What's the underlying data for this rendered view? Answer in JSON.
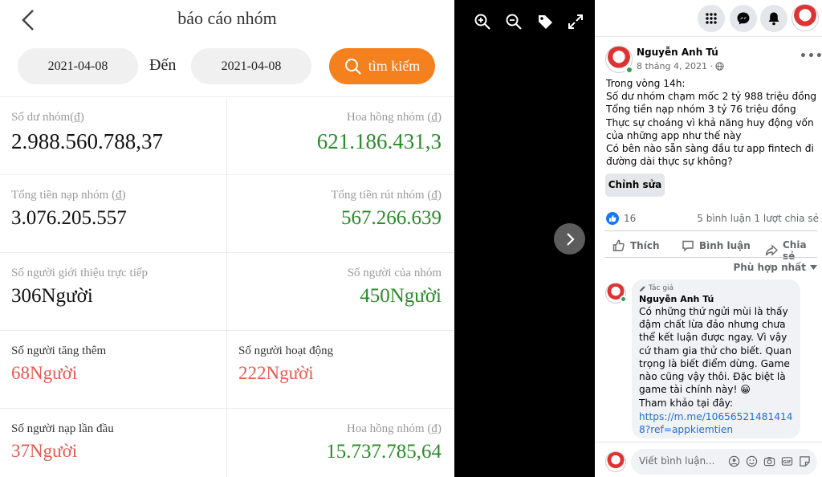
{
  "report": {
    "title": "báo cáo nhóm",
    "date_from": "2021-04-08",
    "den_label": "Đến",
    "date_to": "2021-04-08",
    "search_label": "tìm kiếm",
    "cells": [
      {
        "label": "Số dư nhóm(₫)",
        "value": "2.988.560.788,37"
      },
      {
        "label": "Hoa hồng nhóm (₫)",
        "value": "621.186.431,3"
      },
      {
        "label": "Tổng tiền nạp nhóm (₫)",
        "value": "3.076.205.557"
      },
      {
        "label": "Tổng tiền rút nhóm (₫)",
        "value": "567.266.639"
      },
      {
        "label": "Số người giới thiệu trực tiếp",
        "value": "306Người"
      },
      {
        "label": "Số người của nhóm",
        "value": "450Người"
      },
      {
        "label": "Số người tăng thêm",
        "value": "68Người"
      },
      {
        "label": "Số người hoạt động",
        "value": "222Người"
      },
      {
        "label": "Số người nạp lần đầu",
        "value": "37Người"
      },
      {
        "label": "Hoa hồng nhóm (₫)",
        "value": "15.737.785,64"
      }
    ]
  },
  "viewer": {
    "icons": [
      "zoom-in-icon",
      "zoom-out-icon",
      "tag-icon",
      "fullscreen-icon"
    ]
  },
  "fb": {
    "top_icons": [
      "menu-grid-icon",
      "messenger-icon",
      "notification-bell-icon"
    ],
    "post": {
      "author": "Nguyễn Anh Tú",
      "date": "8 tháng 4, 2021 ·",
      "lines": [
        "Trong vòng 14h:",
        "Số dư nhóm chạm mốc 2 tỷ 988 triệu đồng",
        "Tổng tiền nạp nhóm 3 tỷ 76 triệu đồng",
        "Thực sự choáng vì khả năng huy động vốn của những app như thế này",
        "Có bên nào sẵn sàng đầu tư app fintech đi đường dài thực sự không?"
      ],
      "edit_label": "Chỉnh sửa",
      "likes": "16",
      "counts": "5 bình luận  1 lượt chia sẻ",
      "like_action": "Thích",
      "comment_action": "Bình luận",
      "share_action": "Chia sẻ",
      "sort_label": "Phù hợp nhất"
    },
    "comment": {
      "badge": "Tác giả",
      "author": "Nguyễn Anh Tú",
      "text": "Có những thứ ngửi mùi là thấy đậm chất lừa đảo nhưng chưa thể kết luận được ngay. Vì vậy cứ tham gia thử cho biết. Quan trọng là biết điểm dừng. Game nào cũng vậy thôi. Đặc biệt là game tài chính này! 😀",
      "ref_label": "Tham khảo tại đây:",
      "link": "https://m.me/106565214814148?ref=appkiemtien"
    },
    "comment_placeholder": "Viết bình luận..."
  }
}
